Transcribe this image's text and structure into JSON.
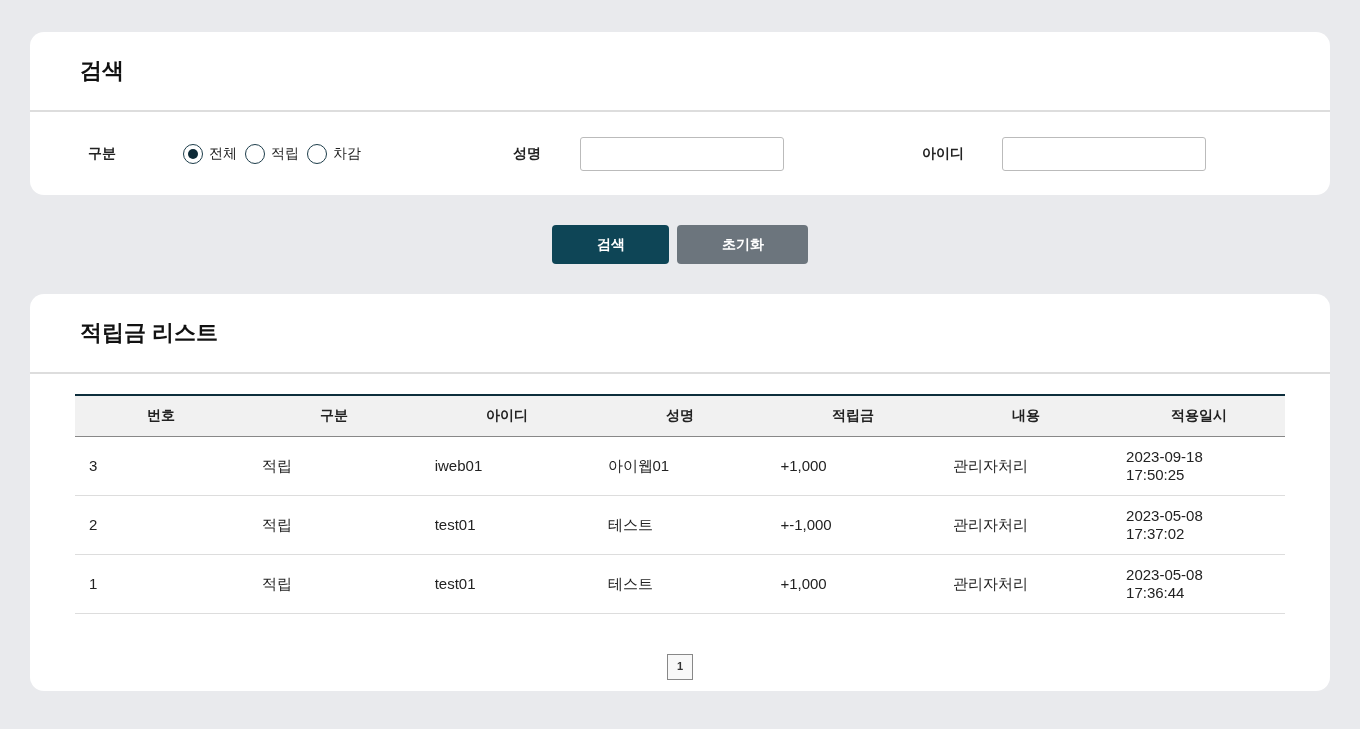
{
  "search_panel": {
    "title": "검색",
    "type_label": "구분",
    "type_options": [
      {
        "label": "전체",
        "selected": true
      },
      {
        "label": "적립",
        "selected": false
      },
      {
        "label": "차감",
        "selected": false
      }
    ],
    "fields": [
      {
        "label": "성명"
      },
      {
        "label": "아이디"
      }
    ]
  },
  "buttons": [
    {
      "label": "검색",
      "kind": "primary"
    },
    {
      "label": "초기화",
      "kind": "secondary"
    }
  ],
  "list_panel": {
    "title": "적립금 리스트",
    "table": {
      "columns": [
        "번호",
        "구분",
        "아이디",
        "성명",
        "적립금",
        "내용",
        "적용일시"
      ],
      "rows": [
        [
          "3",
          "적립",
          "iweb01",
          "아이웹01",
          "+1,000",
          "관리자처리",
          "2023-09-18 17:50:25"
        ],
        [
          "2",
          "적립",
          "test01",
          "테스트",
          "+-1,000",
          "관리자처리",
          "2023-05-08 17:37:02"
        ],
        [
          "1",
          "적립",
          "test01",
          "테스트",
          "+1,000",
          "관리자처리",
          "2023-05-08 17:36:44"
        ]
      ]
    },
    "pagination": [
      {
        "label": "1",
        "selected": true
      }
    ]
  }
}
